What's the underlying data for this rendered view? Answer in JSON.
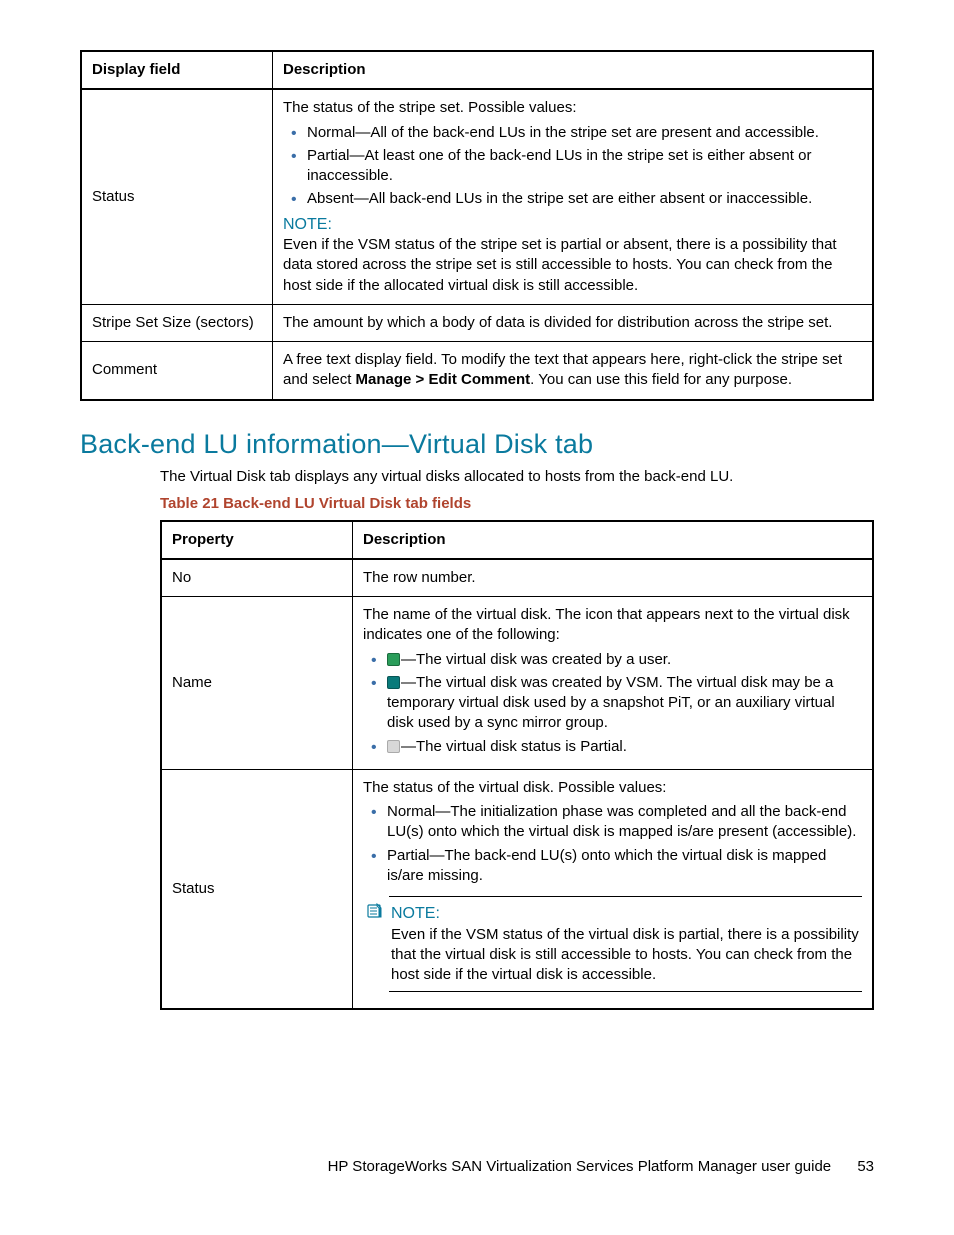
{
  "table1": {
    "headers": {
      "col1": "Display field",
      "col2": "Description"
    },
    "rows": {
      "status": {
        "field": "Status",
        "intro": "The status of the stripe set. Possible values:",
        "bullets": [
          "Normal—All of the back-end LUs in the stripe set are present and accessible.",
          "Partial—At least one of the back-end LUs in the stripe set is either absent or inaccessible.",
          "Absent—All back-end LUs in the stripe set are either absent or inaccessible."
        ],
        "note_label": "NOTE:",
        "note_body": "Even if the VSM status of the stripe set is partial or absent, there is a possibility that data stored across the stripe set is still accessible to hosts. You can check from the host side if the allocated virtual disk is still accessible."
      },
      "size": {
        "field": "Stripe Set Size (sectors)",
        "desc": "The amount by which a body of data is divided for distribution across the stripe set."
      },
      "comment": {
        "field": "Comment",
        "desc_pre": "A free text display field. To modify the text that appears here, right-click the stripe set and select ",
        "desc_bold": "Manage > Edit Comment",
        "desc_post": ". You can use this field for any purpose."
      }
    }
  },
  "section_heading": "Back-end LU information—Virtual Disk tab",
  "section_intro": "The Virtual Disk tab displays any virtual disks allocated to hosts from the back-end LU.",
  "table2_caption": "Table 21 Back-end LU Virtual Disk tab fields",
  "table2": {
    "headers": {
      "col1": "Property",
      "col2": "Description"
    },
    "rows": {
      "no": {
        "field": "No",
        "desc": "The row number."
      },
      "name": {
        "field": "Name",
        "intro": "The name of the virtual disk. The icon that appears next to the virtual disk indicates one of the following:",
        "b1_post": "—The virtual disk was created by a user.",
        "b2_post": "—The virtual disk was created by VSM. The virtual disk may be a temporary virtual disk used by a snapshot PiT, or an auxiliary virtual disk used by a sync mirror group.",
        "b3_post": "—The virtual disk status is Partial."
      },
      "status": {
        "field": "Status",
        "intro": "The status of the virtual disk. Possible values:",
        "bullets": [
          "Normal—The initialization phase was completed and all the back-end LU(s) onto which the virtual disk is mapped is/are present (accessible).",
          "Partial—The back-end LU(s) onto which the virtual disk is mapped is/are missing."
        ],
        "note_label": "NOTE:",
        "note_body": "Even if the VSM status of the virtual disk is partial, there is a possibility that the virtual disk is still accessible to hosts. You can check from the host side if the virtual disk is accessible."
      }
    }
  },
  "footer": {
    "title": "HP StorageWorks SAN Virtualization Services Platform Manager user guide",
    "page": "53"
  }
}
